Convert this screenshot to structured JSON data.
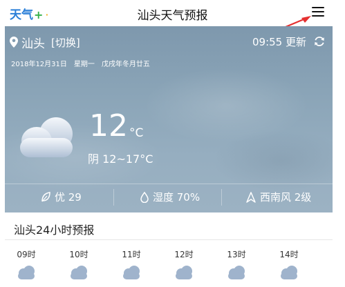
{
  "header": {
    "logo_text": "天气",
    "logo_plus": "+",
    "logo_dot": "·",
    "title": "汕头天气预报"
  },
  "weather": {
    "city": "汕头",
    "switch_label": "[切换]",
    "date": "2018年12月31日　星期一　戊戌年冬月廿五",
    "update_time": "09:55 更新",
    "temperature": "12",
    "temp_unit": "°C",
    "condition": "阴 12~17°C",
    "air_quality": "优 29",
    "humidity": "湿度 70%",
    "wind": "西南风 2级"
  },
  "forecast": {
    "title": "汕头24小时预报",
    "hours": [
      "09时",
      "10时",
      "11时",
      "12时",
      "13时",
      "14时"
    ]
  },
  "colors": {
    "panel_top": "#7e98ad",
    "panel_bottom": "#9cb2c3",
    "logo_blue": "#2b7fd8",
    "logo_green": "#35b04a",
    "arrow_red": "#e53030",
    "cloud_blue": "#9fb3cc"
  },
  "icons": [
    "menu-icon",
    "location-pin-icon",
    "refresh-icon",
    "cloud-icon",
    "leaf-icon",
    "water-drop-icon",
    "wind-icon"
  ]
}
